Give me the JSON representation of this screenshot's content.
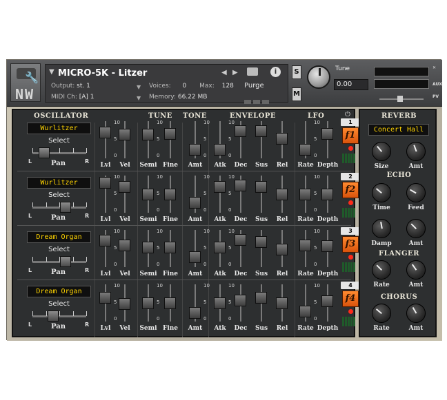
{
  "header": {
    "instrument_name": "MICRO-5K - Litzer",
    "logo_text": "NW",
    "output_label": "Output:",
    "output_value": "st. 1",
    "voices_label": "Voices:",
    "voices_value": "0",
    "max_label": "Max:",
    "max_value": "128",
    "midi_label": "MIDI Ch:",
    "midi_value": "[A] 1",
    "memory_label": "Memory:",
    "memory_value": "66.22 MB",
    "purge_label": "Purge",
    "solo_label": "S",
    "mute_label": "M",
    "tune_label": "Tune",
    "tune_value": "0.00",
    "aux_label": "AUX",
    "pv_label": "PV"
  },
  "sections": {
    "oscillator": "OSCILLATOR",
    "tune": "TUNE",
    "tone": "TONE",
    "envelope": "ENVELOPE",
    "lfo": "LFO",
    "reverb": "REVERB",
    "echo": "ECHO",
    "flanger": "FLANGER",
    "chorus": "CHORUS"
  },
  "labels": {
    "select": "Select",
    "pan": "Pan",
    "left": "L",
    "right": "R",
    "lvl": "Lvl",
    "vel": "Vel",
    "semi": "Semi",
    "fine": "Fine",
    "amt": "Amt",
    "atk": "Atk",
    "dec": "Dec",
    "sus": "Sus",
    "rel": "Rel",
    "rate": "Rate",
    "depth": "Depth",
    "size": "Size",
    "time": "Time",
    "feed": "Feed",
    "damp": "Damp",
    "scale_top": "10",
    "scale_mid": "5",
    "scale_zero": "0"
  },
  "rows": [
    {
      "num": "1",
      "sound": "Wurlitzer",
      "lfo_button": "f1",
      "pan": 0.22,
      "faders": [
        0.78,
        0.7,
        0.7,
        0.72,
        0.12,
        0.12,
        0.85,
        0.85,
        0.55,
        0.12,
        0.72
      ]
    },
    {
      "num": "2",
      "sound": "Wurlitzer",
      "lfo_button": "f2",
      "pan": 0.62,
      "faders": [
        0.95,
        0.78,
        0.48,
        0.5,
        0.15,
        0.78,
        0.85,
        0.78,
        0.48,
        0.48,
        0.48
      ]
    },
    {
      "num": "3",
      "sound": "Dream Organ",
      "lfo_button": "f3",
      "pan": 0.62,
      "faders": [
        0.8,
        0.62,
        0.55,
        0.55,
        0.15,
        0.55,
        0.85,
        0.75,
        0.45,
        0.62,
        0.6
      ]
    },
    {
      "num": "4",
      "sound": "Dream Organ",
      "lfo_button": "f4",
      "pan": 0.38,
      "faders": [
        0.7,
        0.45,
        0.5,
        0.5,
        0.1,
        0.5,
        0.6,
        0.7,
        0.5,
        0.15,
        0.58
      ]
    }
  ],
  "reverb": {
    "preset": "Concert Hall"
  }
}
